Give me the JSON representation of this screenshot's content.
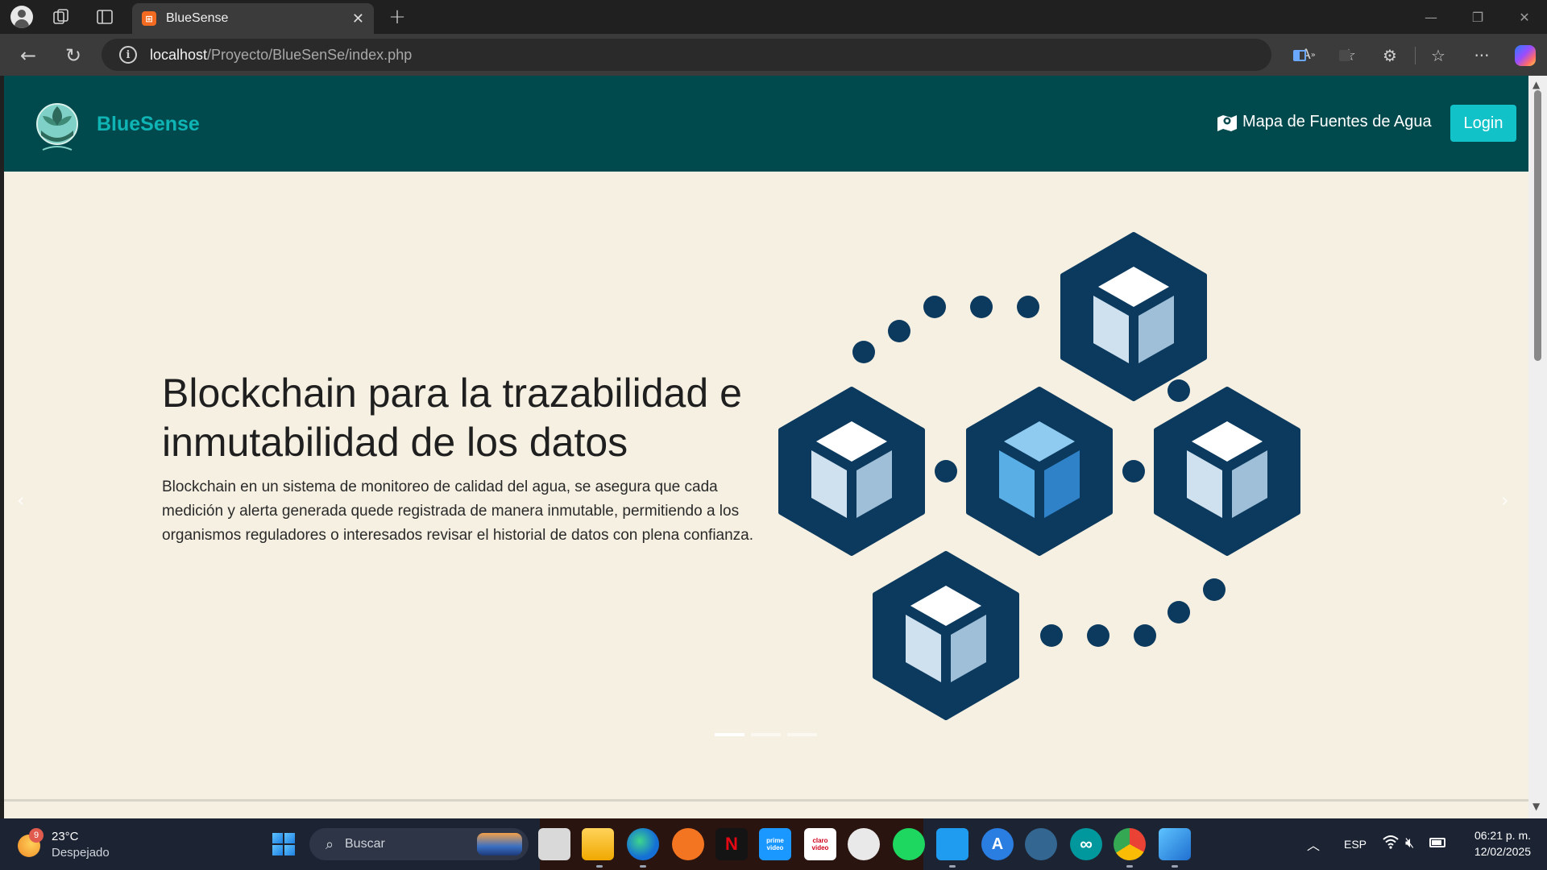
{
  "browser": {
    "tab_title": "BlueSense",
    "url_host": "localhost",
    "url_path": "/Proyecto/BlueSenSe/index.php",
    "favicon_letter": "⊞",
    "icons": [
      "profile-icon",
      "workspaces-icon",
      "tab-actions-icon",
      "close-icon",
      "plus-icon",
      "back-icon",
      "reload-icon",
      "site-info-icon",
      "read-aloud-icon",
      "star-icon",
      "split-screen-icon",
      "extensions-icon",
      "favorites-icon",
      "more-icon",
      "copilot-icon"
    ]
  },
  "navbar": {
    "brand": "BlueSense",
    "map_link": "Mapa de Fuentes de Agua",
    "login": "Login"
  },
  "hero": {
    "title": "Blockchain para la trazabilidad e inmutabilidad de los datos",
    "text": "Blockchain en un sistema de monitoreo de calidad del agua, se asegura que cada medición y alerta generada quede registrada de manera inmutable, permitiendo a los organismos reguladores o interesados revisar el historial de datos con plena confianza.",
    "slides": 3,
    "active_slide": 1
  },
  "colors": {
    "navbar": "#004a4e",
    "brand": "#0fb4b4",
    "login": "#11c3c9",
    "page_bg": "#f6f0e2",
    "cube_dark": "#0b3a5e",
    "cube_accent": "#5aaee6"
  },
  "taskbar": {
    "weather_badge": "9",
    "weather_temp": "23°C",
    "weather_desc": "Despejado",
    "search": "Buscar",
    "lang": "ESP",
    "time": "06:21 p. m.",
    "date": "12/02/2025",
    "apps": [
      {
        "name": "file-explorer-blank",
        "label": ""
      },
      {
        "name": "file-explorer",
        "label": ""
      },
      {
        "name": "edge",
        "label": ""
      },
      {
        "name": "crunchyroll",
        "label": ""
      },
      {
        "name": "netflix",
        "label": "N"
      },
      {
        "name": "prime-video",
        "label": "prime video"
      },
      {
        "name": "claro-video",
        "label": "claro video"
      },
      {
        "name": "game-app",
        "label": ""
      },
      {
        "name": "spotify",
        "label": ""
      },
      {
        "name": "vscode",
        "label": ""
      },
      {
        "name": "app-store",
        "label": "A"
      },
      {
        "name": "postgresql",
        "label": ""
      },
      {
        "name": "arduino",
        "label": "∞"
      },
      {
        "name": "chrome",
        "label": ""
      },
      {
        "name": "photos",
        "label": ""
      }
    ]
  }
}
